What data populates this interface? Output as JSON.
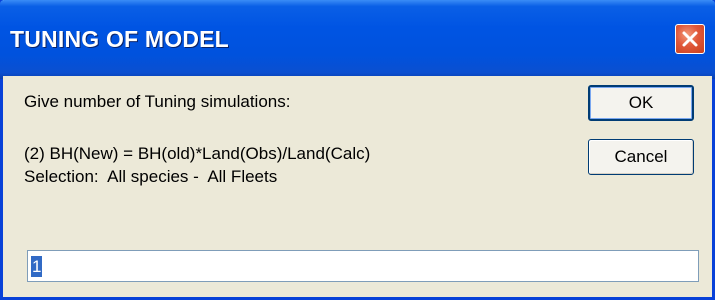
{
  "dialog": {
    "title": "TUNING OF MODEL",
    "prompt": "Give number of Tuning simulations:",
    "formula": "(2) BH(New) = BH(old)*Land(Obs)/Land(Calc)",
    "selection": "Selection:  All species -  All Fleets",
    "input_value": "1",
    "ok_label": "OK",
    "cancel_label": "Cancel"
  },
  "colors": {
    "titlebar": "#0054e3",
    "close_button": "#e0583a",
    "dialog_background": "#ece9d8",
    "selection_highlight": "#316ac5"
  }
}
